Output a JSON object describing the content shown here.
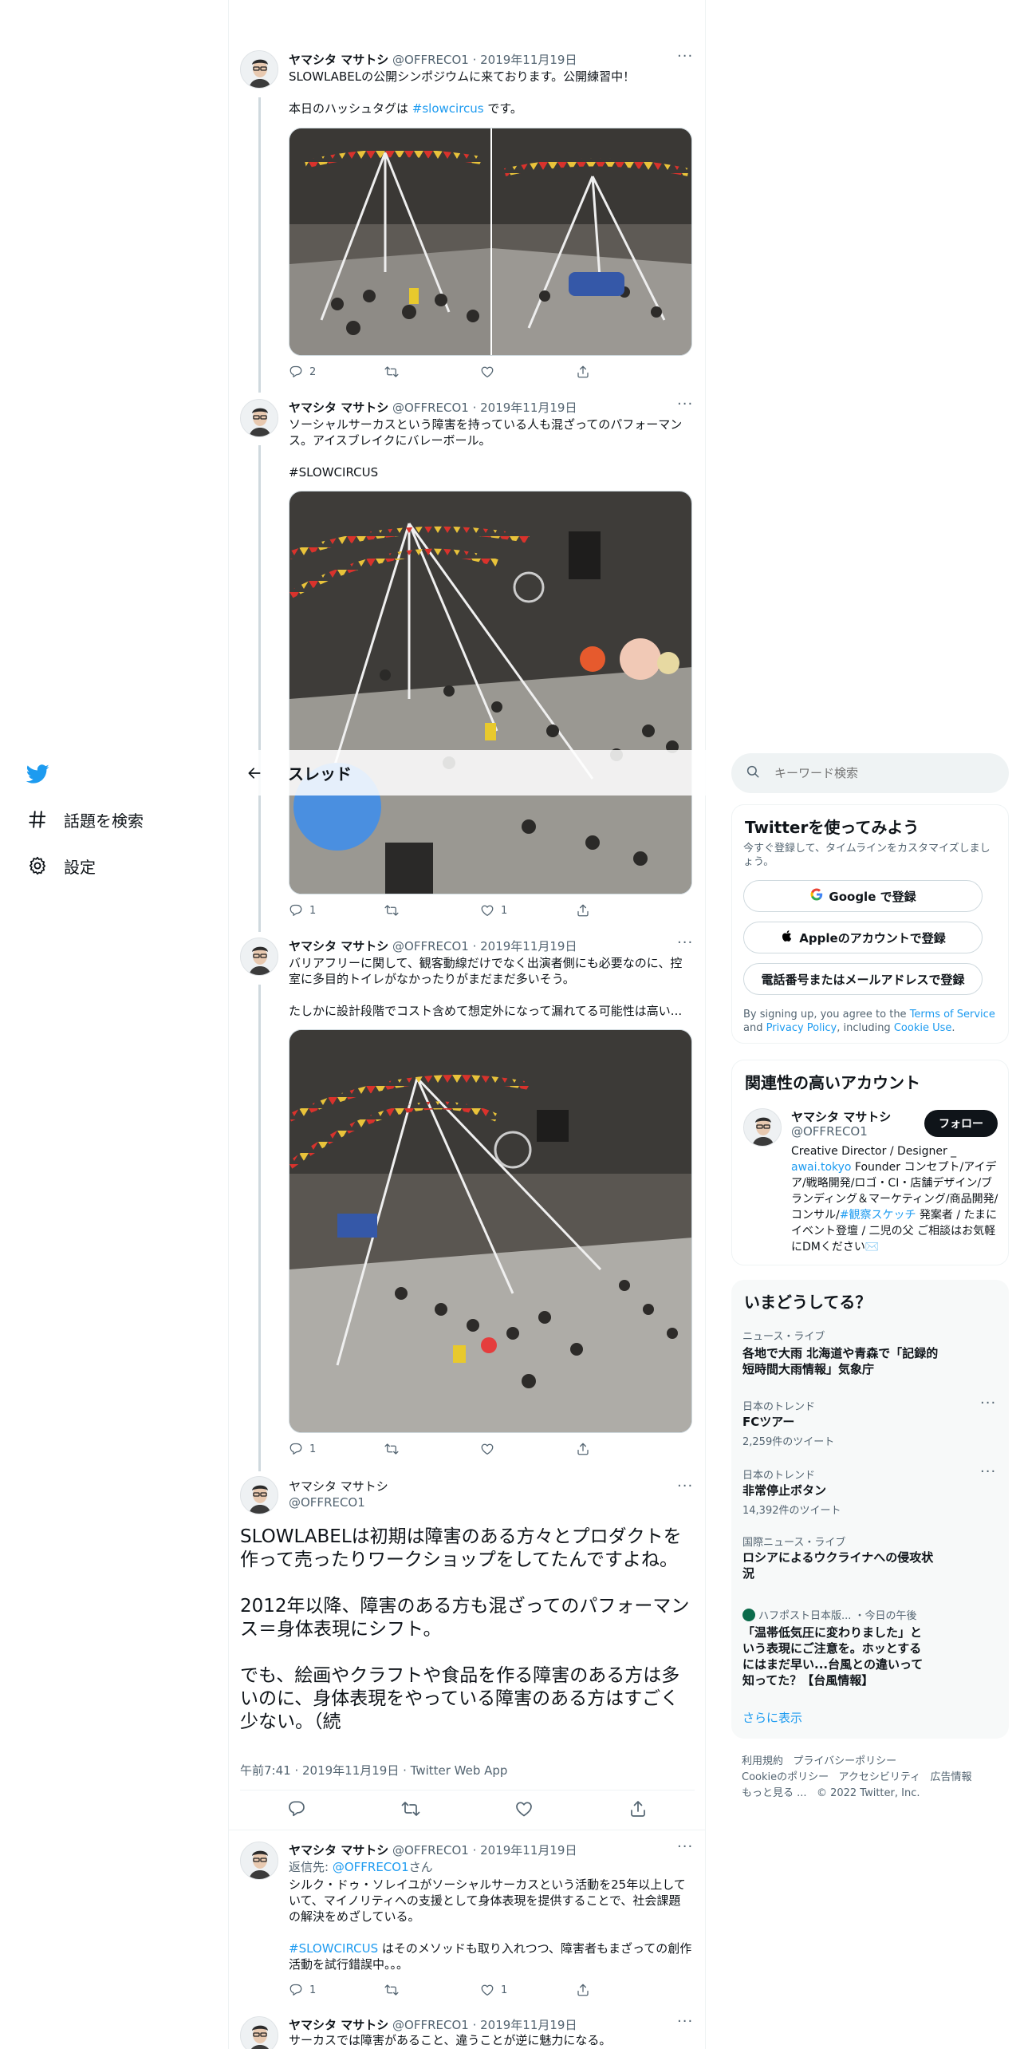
{
  "nav": {
    "explore_label": "話題を検索",
    "settings_label": "設定"
  },
  "header": {
    "title": "スレッド"
  },
  "search": {
    "placeholder": "キーワード検索"
  },
  "signup": {
    "title": "Twitterを使ってみよう",
    "subtitle": "今すぐ登録して、タイムラインをカスタマイズしましょう。",
    "google_label": "Google で登録",
    "apple_label": "Appleのアカウントで登録",
    "phone_label": "電話番号またはメールアドレスで登録",
    "terms_pre": "By signing up, you agree to the ",
    "terms_link": "Terms of Service",
    "terms_and": " and",
    "privacy_link": "Privacy Policy",
    "terms_mid": ", including ",
    "cookie_link": "Cookie Use",
    "terms_end": "."
  },
  "related": {
    "title": "関連性の高いアカウント",
    "name": "ヤマシタ マサトシ",
    "handle": "@OFFRECO1",
    "follow_label": "フォロー",
    "bio_1": "Creative Director / Designer _",
    "bio_link": "awai.tokyo",
    "bio_2": " Founder コンセプト/アイデア/戦略開発/ロゴ・CI・店舗デザイン/ブランディング＆マーケティング/商品開発/コンサル/",
    "bio_tag": "#観察スケッチ",
    "bio_3": " 発案者 / たまにイベント登壇 / 二児の父 ご相談はお気軽にDMください✉️"
  },
  "trends": {
    "title": "いまどうしてる？",
    "items": [
      {
        "category": "ニュース・ライブ",
        "title": "各地で大雨 北海道や青森で「記録的短時間大雨情報」気象庁",
        "count": ""
      },
      {
        "category": "日本のトレンド",
        "title": "FCツアー",
        "count": "2,259件のツイート"
      },
      {
        "category": "日本のトレンド",
        "title": "非常停止ボタン",
        "count": "14,392件のツイート"
      },
      {
        "category": "国際ニュース・ライブ",
        "title": "ロシアによるウクライナへの侵攻状況",
        "count": ""
      },
      {
        "category": "ハフポスト日本版... ・今日の午後",
        "title": "「温帯低気圧に変わりました」という表現にご注意を。ホッとするにはまだ早い...台風との違いって知ってた？【台風情報】",
        "count": ""
      }
    ],
    "more_label": "さらに表示"
  },
  "footer": {
    "terms": "利用規約",
    "privacy": "プライバシーポリシー",
    "cookie": "Cookieのポリシー",
    "accessibility": "アクセシビリティ",
    "ads": "広告情報",
    "more": "もっと見る ...",
    "copyright": "© 2022 Twitter, Inc."
  },
  "tweets": [
    {
      "name": "ヤマシタ マサトシ",
      "handle_date": "@OFFRECO1 · 2019年11月19日",
      "text_1": "SLOWLABELの公開シンポジウムに来ております。公開練習中！",
      "text_2_pre": "本日のハッシュタグは ",
      "text_2_tag": "#slowcircus",
      "text_2_post": " です。",
      "reply_count": "2",
      "retweet_count": "",
      "like_count": ""
    },
    {
      "name": "ヤマシタ マサトシ",
      "handle_date": "@OFFRECO1 · 2019年11月19日",
      "text_1": "ソーシャルサーカスという障害を持っている人も混ざってのパフォーマンス。アイスブレイクにバレーボール。",
      "tag": "#SLOWCIRCUS",
      "reply_count": "1",
      "retweet_count": "",
      "like_count": "1"
    },
    {
      "name": "ヤマシタ マサトシ",
      "handle_date": "@OFFRECO1 · 2019年11月19日",
      "text_1": "バリアフリーに関して、観客動線だけでなく出演者側にも必要なのに、控室に多目的トイレがなかったりがまだまだ多いそう。",
      "text_2": "たしかに設計段階でコスト含めて想定外になって漏れてる可能性は高い...",
      "reply_count": "1",
      "retweet_count": "",
      "like_count": ""
    }
  ],
  "main_tweet": {
    "name": "ヤマシタ マサトシ",
    "handle": "@OFFRECO1",
    "text": "SLOWLABELは初期は障害のある方々とプロダクトを作って売ったりワークショップをしてたんですよね。\n\n2012年以降、障害のある方も混ざってのパフォーマンス＝身体表現にシフト。\n\nでも、絵画やクラフトや食品を作る障害のある方は多いのに、身体表現をやっている障害のある方はすごく少ない。（続",
    "timestamp": "午前7:41 · 2019年11月19日 · Twitter Web App"
  },
  "replies": [
    {
      "name": "ヤマシタ マサトシ",
      "handle_date": "@OFFRECO1 · 2019年11月19日",
      "reply_to_pre": "返信先: ",
      "reply_to_handle": "@OFFRECO1",
      "reply_to_post": "さん",
      "text_1": "シルク・ドゥ・ソレイユがソーシャルサーカスという活動を25年以上していて、マイノリティへの支援として身体表現を提供することで、社会課題の解決をめざしている。",
      "tag": "#SLOWCIRCUS",
      "text_2": " はそのメソッドも取り入れつつ、障害者もまざっての創作活動を試行錯誤中。。。",
      "reply_count": "1",
      "like_count": "1"
    },
    {
      "name": "ヤマシタ マサトシ",
      "handle_date": "@OFFRECO1 · 2019年11月19日",
      "text_1": "サーカスでは障害があること、違うことが逆に魅力になる。"
    }
  ],
  "colors": {
    "accent": "#1d9bf0",
    "text": "#0f1419",
    "secondary": "#536471",
    "border": "#eff3f4",
    "card_bg": "#f7f9f9"
  }
}
